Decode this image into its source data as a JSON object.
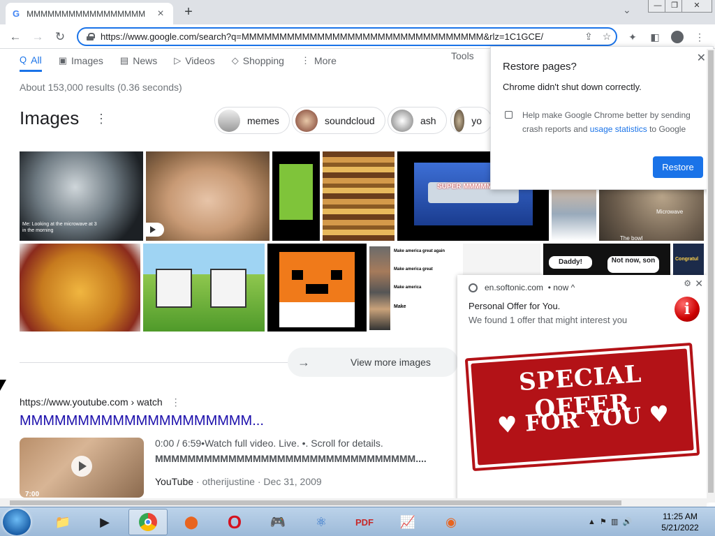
{
  "tab": {
    "title": "MMMMMMMMMMMMMMMMM",
    "favicon": "G"
  },
  "window": {
    "minimize": "—",
    "restore": "❐",
    "close": "✕"
  },
  "omnibox": {
    "url": "https://www.google.com/search?q=MMMMMMMMMMMMMMMMMMMMMMMMMMMMMMMM&rlz=1C1GCE/"
  },
  "search_tabs": [
    {
      "icon": "Q",
      "label": "All"
    },
    {
      "icon": "▣",
      "label": "Images"
    },
    {
      "icon": "▤",
      "label": "News"
    },
    {
      "icon": "▷",
      "label": "Videos"
    },
    {
      "icon": "◇",
      "label": "Shopping"
    },
    {
      "icon": "⋮",
      "label": "More"
    }
  ],
  "tools": "Tools",
  "stats": "About 153,000 results (0.36 seconds)",
  "images": {
    "heading": "Images",
    "chips": [
      "memes",
      "soundcloud",
      "ash",
      "yo"
    ],
    "thumb_caption": "Me: Looking at the microwave at 3 in the morning",
    "super_label": "SUPER MMMMMMMM",
    "microwave_caption": "Microwave",
    "bowl_caption": "The bowl",
    "daddy_caption": "Daddy!",
    "notnow_caption": "Not now, son",
    "congrats_caption": "Congratul",
    "america_lines": [
      "Make america great again",
      "Make america great",
      "Make america",
      "Make"
    ],
    "view_more": "View more images"
  },
  "result": {
    "url": "https://www.youtube.com › watch",
    "title": "MMMMMMMMMMMMMMMMMMMM...",
    "meta1": "0:00 / 6:59•Watch full video. Live. •. Scroll for details.",
    "meta2": "MMMMMMMMMMMMMMMMMMMMMMMMMMMMMMMM....",
    "source": "YouTube",
    "author": "otherijustine",
    "date": "Dec 31, 2009",
    "duration": "7:00"
  },
  "restore_popup": {
    "title": "Restore pages?",
    "message": "Chrome didn't shut down correctly.",
    "checkbox_text_a": "Help make Google Chrome better by sending crash reports and ",
    "checkbox_link": "usage statistics",
    "checkbox_text_b": " to Google",
    "button": "Restore"
  },
  "notification": {
    "site": "en.softonic.com",
    "time": "• now ^",
    "title": "Personal Offer for You.",
    "body": "We found 1 offer that might interest you",
    "banner_line1": "SPECIAL OFFER",
    "banner_line2": "♥ FOR YOU ♥"
  },
  "taskbar": {
    "time": "11:25 AM",
    "date": "5/21/2022"
  }
}
